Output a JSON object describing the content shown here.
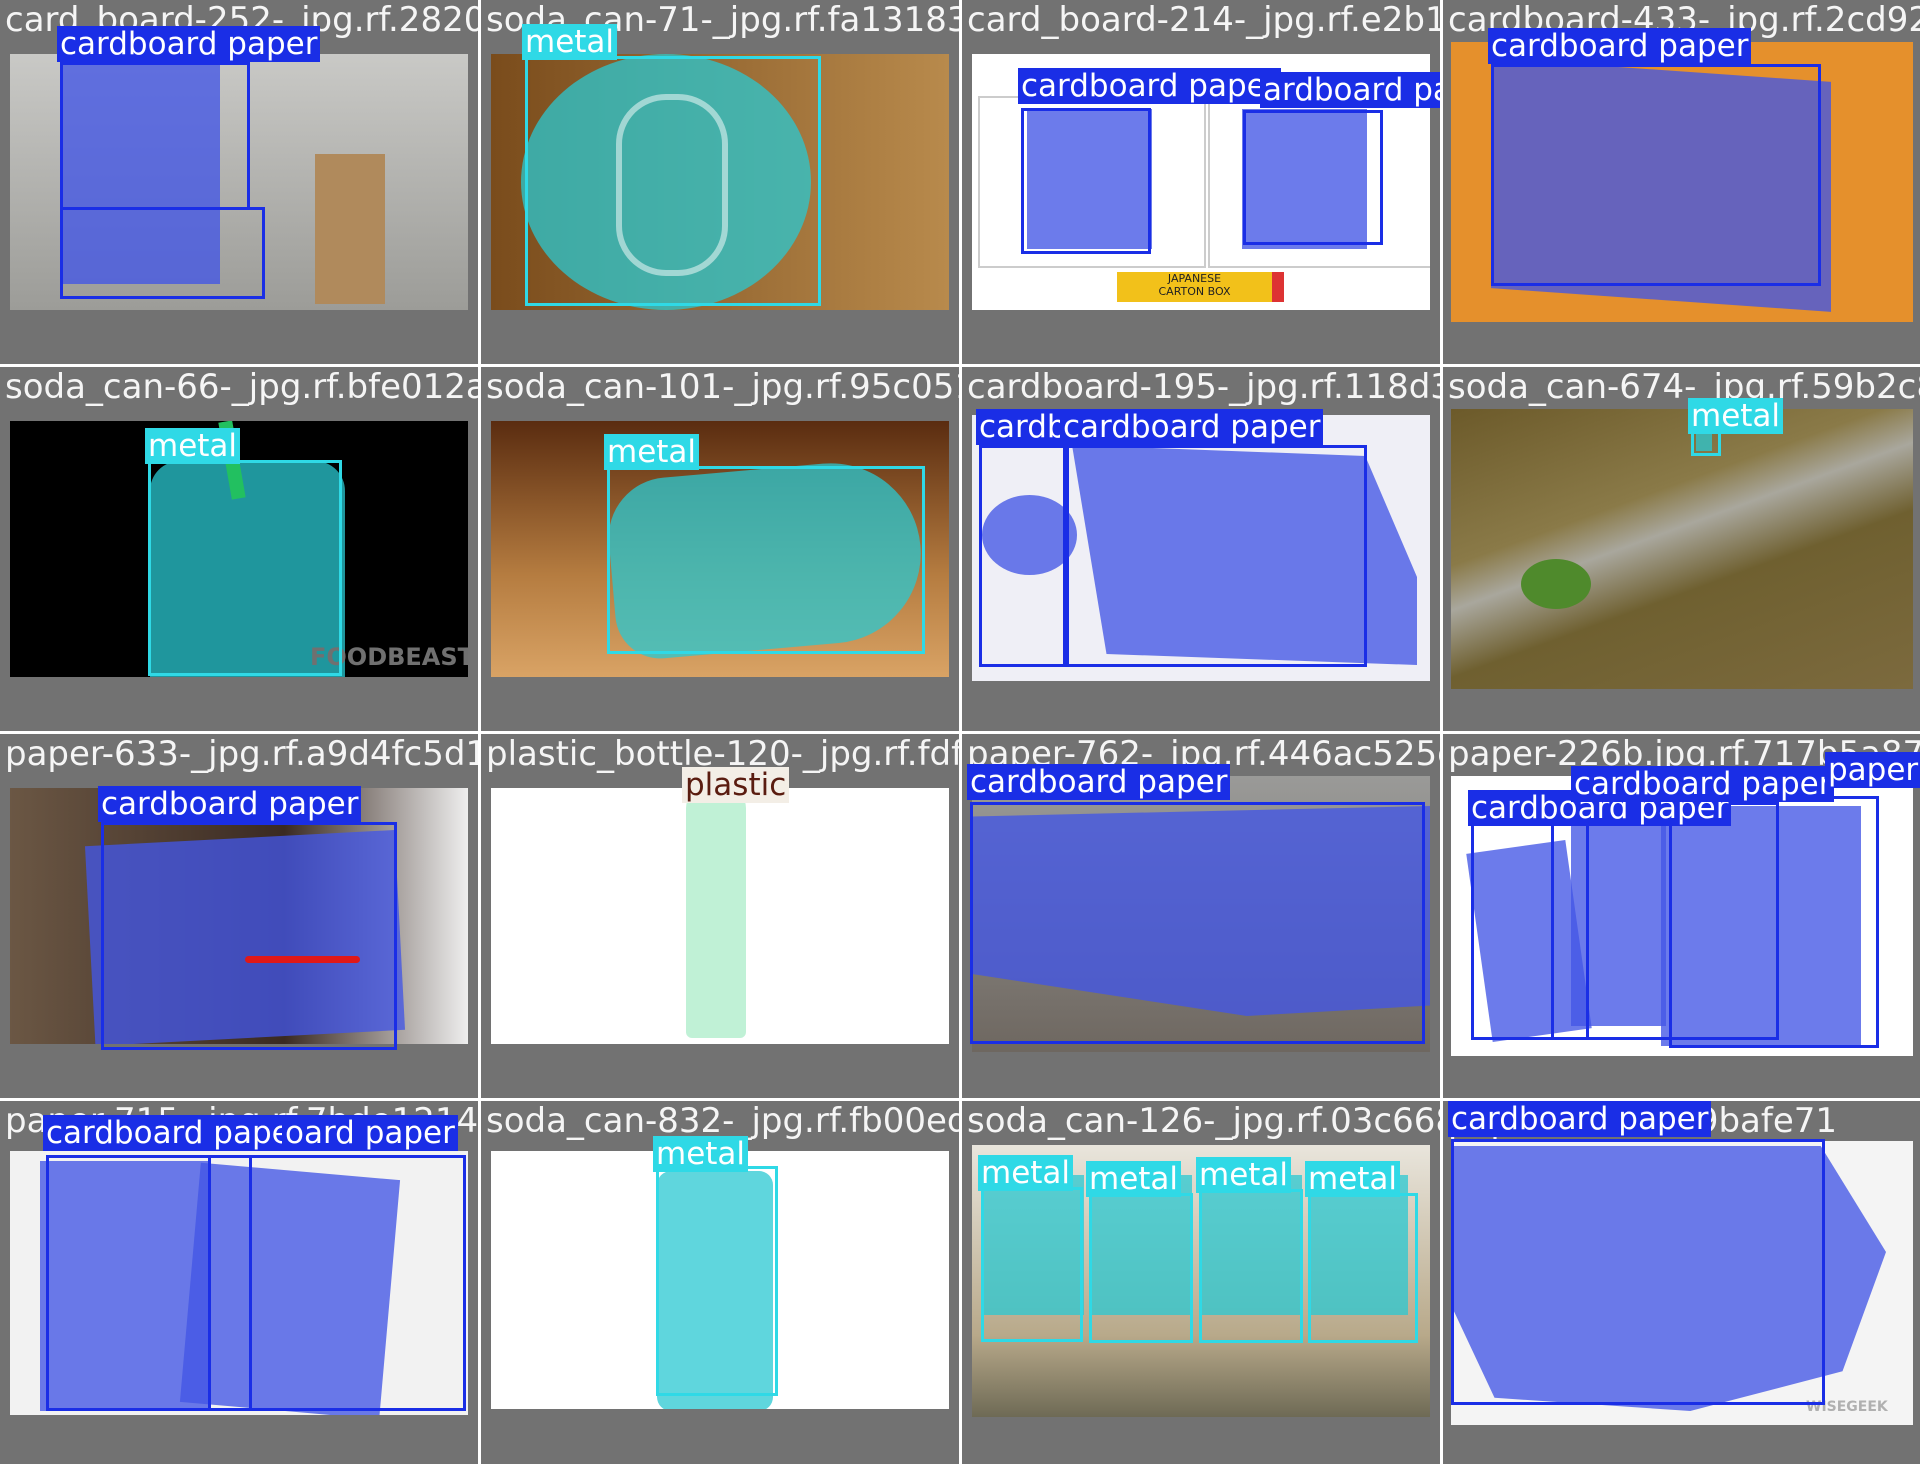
{
  "colors": {
    "cardboard": "#1a2ee6",
    "cardboard_mask": "rgba(66,86,230,0.78)",
    "metal": "#2fd9e6",
    "metal_mask": "rgba(42,200,210,0.75)",
    "plastic": "#f3eee6",
    "plastic_text": "#5a1c10",
    "plastic_mask": "rgba(140,230,180,0.55)"
  },
  "labels": {
    "cardboard": "cardboard paper",
    "metal": "metal",
    "plastic": "plastic"
  },
  "tiles": [
    {
      "id": "r0c0",
      "file": "card_board-252-_jpg.rf.28203e4a5d18a7f97197-_jpg.rf.fa13183476",
      "photo": "robot-figures",
      "labels": [
        "cardboard paper"
      ]
    },
    {
      "id": "r0c1",
      "file": "soda_can-71-_jpg.rf.fa131834761797197",
      "photo": "can-top",
      "labels": [
        "metal"
      ]
    },
    {
      "id": "r0c2",
      "file": "card_board-214-_jpg.rf.e2b14eac4ad641",
      "photo": "japanese-carton",
      "labels": [
        "cardboard paper",
        "ardboard paper"
      ],
      "caption": "JAPANESE\nCARTON BOX"
    },
    {
      "id": "r0c3",
      "file": "cardboard-433-_jpg.rf.2cd922a5",
      "photo": "pizza-box",
      "labels": [
        "cardboard paper"
      ]
    },
    {
      "id": "r1c0",
      "file": "soda_can-66-_jpg.rf.bfe012af767dead2b6494101",
      "photo": "can-straw",
      "labels": [
        "metal"
      ],
      "watermark": "FOODBEAST"
    },
    {
      "id": "r1c1",
      "file": "soda_can-101-_jpg.rf.95c05114acfa8f92ad",
      "photo": "cola-can",
      "labels": [
        "metal"
      ]
    },
    {
      "id": "r1c2",
      "file": "cardboard-195-_jpg.rf.118d39d5d2f1fbea",
      "photo": "open-box",
      "labels": [
        "cardb",
        "cardboard paper"
      ]
    },
    {
      "id": "r1c3",
      "file": "soda_can-674-_jpg.rf.59b2c8758",
      "photo": "ground",
      "labels": [
        "metal"
      ]
    },
    {
      "id": "r2c0",
      "file": "paper-633-_jpg.rf.a9d4fc5d1825316ab5f67",
      "photo": "classifieds",
      "labels": [
        "cardboard paper"
      ]
    },
    {
      "id": "r2c1",
      "file": "plastic_bottle-120-_jpg.rf.fdf37462f4138",
      "photo": "bottle",
      "labels": [
        "plastic"
      ]
    },
    {
      "id": "r2c2",
      "file": "paper-762-_jpg.rf.446ac525ec21052a1587",
      "photo": "newspapers",
      "labels": [
        "cardboard paper"
      ]
    },
    {
      "id": "r2c3",
      "file": "paper-226b.jpg.rf.717b5a8743c0",
      "photo": "magazines",
      "labels": [
        "cardboard paper",
        "cardboard paper",
        "paper"
      ]
    },
    {
      "id": "r3c0",
      "file": "paper-715-_jpg.rf.7bde12142a2dbc6407da2b832",
      "photo": "tabloids",
      "labels": [
        "cardboard paper",
        "oard paper"
      ]
    },
    {
      "id": "r3c1",
      "file": "soda_can-832-_jpg.rf.fb00ed8078d8fb53aa1",
      "photo": "green-can",
      "labels": [
        "metal"
      ]
    },
    {
      "id": "r3c2",
      "file": "soda_can-126-_jpg.rf.03c66843c",
      "photo": "four-cans",
      "labels": [
        "metal",
        "metal",
        "metal",
        "metal"
      ]
    },
    {
      "id": "r3c3",
      "file": "paper-.624e5d9bafe71",
      "photo": "paper-pile",
      "labels": [
        "cardboard paper"
      ],
      "watermark": "WISEGEEK"
    }
  ]
}
